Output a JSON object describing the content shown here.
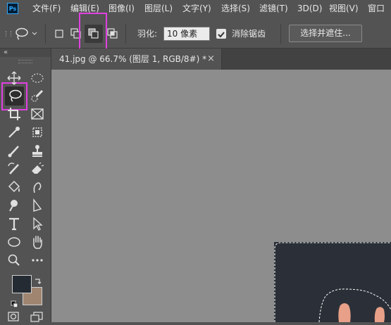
{
  "app": {
    "logo_text": "Ps"
  },
  "menu": {
    "items": [
      "文件(F)",
      "编辑(E)",
      "图像(I)",
      "图层(L)",
      "文字(Y)",
      "选择(S)",
      "滤镜(T)",
      "3D(D)",
      "视图(V)",
      "窗口"
    ]
  },
  "options_bar": {
    "current_tool_icon": "lasso-icon",
    "selection_modes": [
      {
        "name": "new-selection",
        "active": false
      },
      {
        "name": "add-to-selection",
        "active": false
      },
      {
        "name": "subtract-from-selection",
        "active": true
      },
      {
        "name": "intersect-with-selection",
        "active": false
      }
    ],
    "feather_label": "羽化:",
    "feather_value": "10 像素",
    "antialias_label": "消除锯齿",
    "antialias_checked": true,
    "select_and_mask_label": "选择并遮住..."
  },
  "document": {
    "tab_title": "41.jpg @ 66.7% (图层 1, RGB/8#) *",
    "close_glyph": "×"
  },
  "toolbar": {
    "collapse_glyph": "«",
    "foreground_color": "#252b33",
    "background_color": "#a08670",
    "highlight_color": "#e040e0"
  },
  "canvas": {
    "background": "#8d8d8d",
    "image_color": "#2b3038"
  }
}
